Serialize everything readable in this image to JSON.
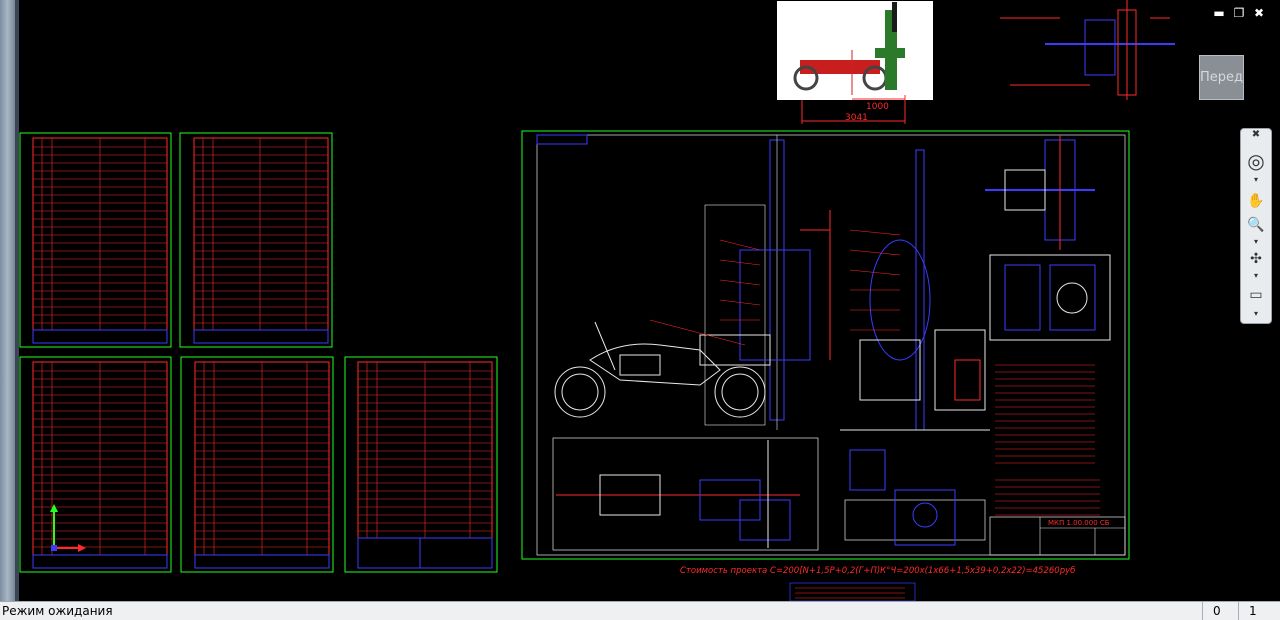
{
  "status": {
    "text": "Режим ожидания",
    "counter_a": "0",
    "counter_b": "1"
  },
  "viewcube": {
    "label": "Перед"
  },
  "window": {
    "minimize": "▬",
    "restore": "❐",
    "close": "✖"
  },
  "drawing": {
    "cost_line": "Стоимость проекта С=200[N+1,5P+0,2(Г+П)К°Ч=200х(1х66+1,5х39+0,2х22)=45260руб",
    "dim_1": "1000",
    "dim_2": "3041",
    "title_block_code": "МКП-1.00.000",
    "sheet_code": "МКП 1.00.000 СБ"
  },
  "colors": {
    "frame": "#22ff22",
    "red_line": "#ff2a2a",
    "blue_line": "#3b3bff",
    "white_line": "#e8e8e8",
    "background": "#000000"
  }
}
